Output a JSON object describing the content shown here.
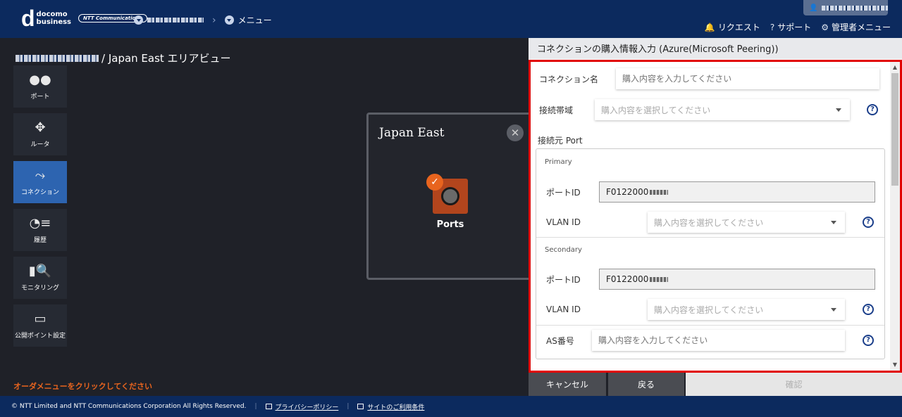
{
  "header": {
    "logo_mark": "d",
    "logo_line1": "docomo",
    "logo_line2": "business",
    "ntt_logo": "NTT Communications",
    "menu_label": "メニュー",
    "nav": [
      {
        "label": "リクエスト",
        "icon": "bell-icon"
      },
      {
        "label": "サポート",
        "icon": "help-circle-icon"
      },
      {
        "label": "管理者メニュー",
        "icon": "gear-icon"
      }
    ]
  },
  "area": {
    "title": "/ Japan East エリアビュー"
  },
  "sidebar": {
    "items": [
      {
        "label": "ポート",
        "icon": "port-icon"
      },
      {
        "label": "ルータ",
        "icon": "router-icon"
      },
      {
        "label": "コネクション",
        "icon": "connection-icon",
        "active": true
      },
      {
        "label": "履歴",
        "icon": "history-icon"
      },
      {
        "label": "モニタリング",
        "icon": "monitoring-icon"
      },
      {
        "label": "公開ポイント設定",
        "icon": "public-point-icon"
      }
    ]
  },
  "order_message": "オーダメニューをクリックしてください",
  "region_card": {
    "title": "Japan East",
    "port_label": "Ports"
  },
  "panel": {
    "title": "コネクションの購入情報入力 (Azure(Microsoft Peering))",
    "connection_name": {
      "label": "コネクション名",
      "placeholder": "購入内容を入力してください"
    },
    "bandwidth": {
      "label": "接続帯域",
      "placeholder": "購入内容を選択してください"
    },
    "source_port_label": "接続元 Port",
    "primary": {
      "heading": "Primary",
      "port_id_label": "ポートID",
      "port_id_value": "F0122000",
      "vlan_label": "VLAN ID",
      "vlan_placeholder": "購入内容を選択してください"
    },
    "secondary": {
      "heading": "Secondary",
      "port_id_label": "ポートID",
      "port_id_value": "F0122000",
      "vlan_label": "VLAN ID",
      "vlan_placeholder": "購入内容を選択してください"
    },
    "as_number": {
      "label": "AS番号",
      "placeholder": "購入内容を入力してください"
    }
  },
  "buttons": {
    "cancel": "キャンセル",
    "back": "戻る",
    "confirm": "確認"
  },
  "footer": {
    "copyright": "© NTT Limited and NTT Communications Corporation All Rights Reserved.",
    "privacy": "プライバシーポリシー",
    "terms": "サイトのご利用条件"
  },
  "colors": {
    "header_bg": "#0c2a5e",
    "accent_orange": "#e8641e",
    "active_blue": "#2d64b0",
    "highlight_red": "#e10000"
  }
}
